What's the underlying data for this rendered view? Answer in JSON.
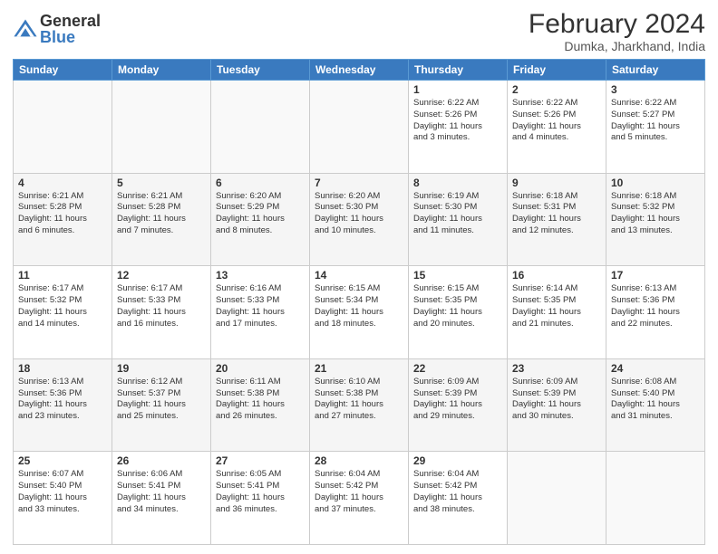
{
  "logo": {
    "general": "General",
    "blue": "Blue"
  },
  "header": {
    "month_year": "February 2024",
    "location": "Dumka, Jharkhand, India"
  },
  "weekdays": [
    "Sunday",
    "Monday",
    "Tuesday",
    "Wednesday",
    "Thursday",
    "Friday",
    "Saturday"
  ],
  "weeks": [
    [
      {
        "day": "",
        "info": ""
      },
      {
        "day": "",
        "info": ""
      },
      {
        "day": "",
        "info": ""
      },
      {
        "day": "",
        "info": ""
      },
      {
        "day": "1",
        "info": "Sunrise: 6:22 AM\nSunset: 5:26 PM\nDaylight: 11 hours\nand 3 minutes."
      },
      {
        "day": "2",
        "info": "Sunrise: 6:22 AM\nSunset: 5:26 PM\nDaylight: 11 hours\nand 4 minutes."
      },
      {
        "day": "3",
        "info": "Sunrise: 6:22 AM\nSunset: 5:27 PM\nDaylight: 11 hours\nand 5 minutes."
      }
    ],
    [
      {
        "day": "4",
        "info": "Sunrise: 6:21 AM\nSunset: 5:28 PM\nDaylight: 11 hours\nand 6 minutes."
      },
      {
        "day": "5",
        "info": "Sunrise: 6:21 AM\nSunset: 5:28 PM\nDaylight: 11 hours\nand 7 minutes."
      },
      {
        "day": "6",
        "info": "Sunrise: 6:20 AM\nSunset: 5:29 PM\nDaylight: 11 hours\nand 8 minutes."
      },
      {
        "day": "7",
        "info": "Sunrise: 6:20 AM\nSunset: 5:30 PM\nDaylight: 11 hours\nand 10 minutes."
      },
      {
        "day": "8",
        "info": "Sunrise: 6:19 AM\nSunset: 5:30 PM\nDaylight: 11 hours\nand 11 minutes."
      },
      {
        "day": "9",
        "info": "Sunrise: 6:18 AM\nSunset: 5:31 PM\nDaylight: 11 hours\nand 12 minutes."
      },
      {
        "day": "10",
        "info": "Sunrise: 6:18 AM\nSunset: 5:32 PM\nDaylight: 11 hours\nand 13 minutes."
      }
    ],
    [
      {
        "day": "11",
        "info": "Sunrise: 6:17 AM\nSunset: 5:32 PM\nDaylight: 11 hours\nand 14 minutes."
      },
      {
        "day": "12",
        "info": "Sunrise: 6:17 AM\nSunset: 5:33 PM\nDaylight: 11 hours\nand 16 minutes."
      },
      {
        "day": "13",
        "info": "Sunrise: 6:16 AM\nSunset: 5:33 PM\nDaylight: 11 hours\nand 17 minutes."
      },
      {
        "day": "14",
        "info": "Sunrise: 6:15 AM\nSunset: 5:34 PM\nDaylight: 11 hours\nand 18 minutes."
      },
      {
        "day": "15",
        "info": "Sunrise: 6:15 AM\nSunset: 5:35 PM\nDaylight: 11 hours\nand 20 minutes."
      },
      {
        "day": "16",
        "info": "Sunrise: 6:14 AM\nSunset: 5:35 PM\nDaylight: 11 hours\nand 21 minutes."
      },
      {
        "day": "17",
        "info": "Sunrise: 6:13 AM\nSunset: 5:36 PM\nDaylight: 11 hours\nand 22 minutes."
      }
    ],
    [
      {
        "day": "18",
        "info": "Sunrise: 6:13 AM\nSunset: 5:36 PM\nDaylight: 11 hours\nand 23 minutes."
      },
      {
        "day": "19",
        "info": "Sunrise: 6:12 AM\nSunset: 5:37 PM\nDaylight: 11 hours\nand 25 minutes."
      },
      {
        "day": "20",
        "info": "Sunrise: 6:11 AM\nSunset: 5:38 PM\nDaylight: 11 hours\nand 26 minutes."
      },
      {
        "day": "21",
        "info": "Sunrise: 6:10 AM\nSunset: 5:38 PM\nDaylight: 11 hours\nand 27 minutes."
      },
      {
        "day": "22",
        "info": "Sunrise: 6:09 AM\nSunset: 5:39 PM\nDaylight: 11 hours\nand 29 minutes."
      },
      {
        "day": "23",
        "info": "Sunrise: 6:09 AM\nSunset: 5:39 PM\nDaylight: 11 hours\nand 30 minutes."
      },
      {
        "day": "24",
        "info": "Sunrise: 6:08 AM\nSunset: 5:40 PM\nDaylight: 11 hours\nand 31 minutes."
      }
    ],
    [
      {
        "day": "25",
        "info": "Sunrise: 6:07 AM\nSunset: 5:40 PM\nDaylight: 11 hours\nand 33 minutes."
      },
      {
        "day": "26",
        "info": "Sunrise: 6:06 AM\nSunset: 5:41 PM\nDaylight: 11 hours\nand 34 minutes."
      },
      {
        "day": "27",
        "info": "Sunrise: 6:05 AM\nSunset: 5:41 PM\nDaylight: 11 hours\nand 36 minutes."
      },
      {
        "day": "28",
        "info": "Sunrise: 6:04 AM\nSunset: 5:42 PM\nDaylight: 11 hours\nand 37 minutes."
      },
      {
        "day": "29",
        "info": "Sunrise: 6:04 AM\nSunset: 5:42 PM\nDaylight: 11 hours\nand 38 minutes."
      },
      {
        "day": "",
        "info": ""
      },
      {
        "day": "",
        "info": ""
      }
    ]
  ]
}
